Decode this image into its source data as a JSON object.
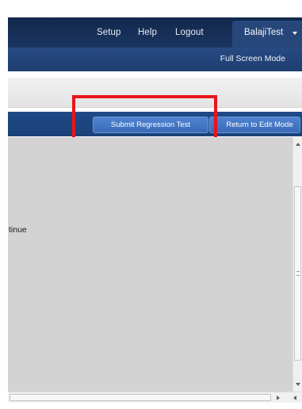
{
  "topnav": {
    "setup_label": "Setup",
    "help_label": "Help",
    "logout_label": "Logout",
    "user_label": "BalajiTest"
  },
  "subnav": {
    "fullscreen_label": "Full Screen Mode"
  },
  "actions": {
    "submit_label": "Submit Regression Test",
    "return_label": "Return to Edit Mode"
  },
  "content": {
    "message_fragment": "tinue"
  },
  "colors": {
    "nav_dark": "#12284c",
    "nav_accent": "#27477a",
    "action_bar": "#1f4a86",
    "button": "#4f83d1",
    "highlight": "#e8141c",
    "content_bg": "#d3d3d3"
  }
}
